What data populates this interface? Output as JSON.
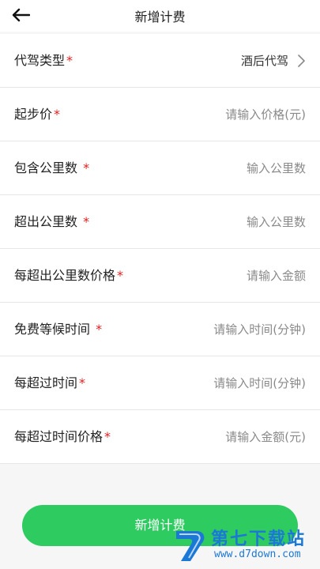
{
  "header": {
    "title": "新增计费"
  },
  "form": {
    "rows": [
      {
        "label": "代驾类型",
        "required": "*",
        "value": "酒后代驾"
      },
      {
        "label": "起步价",
        "required": "*",
        "placeholder": "请输入价格(元)"
      },
      {
        "label": "包含公里数",
        "required": "*",
        "placeholder": "输入公里数"
      },
      {
        "label": "超出公里数",
        "required": "*",
        "placeholder": "输入公里数"
      },
      {
        "label": "每超出公里数价格",
        "required": "*",
        "placeholder": "请输入金额"
      },
      {
        "label": "免费等候时间",
        "required": "*",
        "placeholder": "请输入时间(分钟)"
      },
      {
        "label": "每超过时间",
        "required": "*",
        "placeholder": "请输入时间(分钟)"
      },
      {
        "label": "每超过时间价格",
        "required": "*",
        "placeholder": "请输入金额(元)"
      }
    ]
  },
  "submit": {
    "label": "新增计费"
  },
  "watermark": {
    "title": "第七下载站",
    "url": "www.d7down.com"
  },
  "colors": {
    "accent": "#2ecb61",
    "required": "#e02020",
    "watermark": "#1b78d6"
  }
}
